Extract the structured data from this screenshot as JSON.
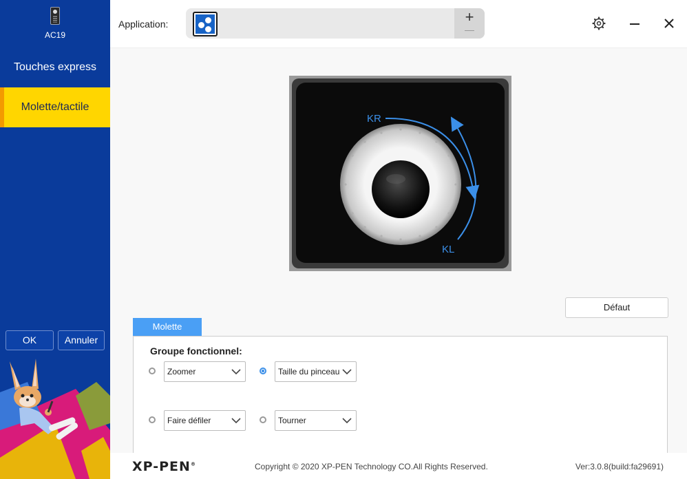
{
  "device": {
    "name": "AC19",
    "icon": "device-icon"
  },
  "sidebar": {
    "items": [
      {
        "label": "Touches express",
        "active": false
      },
      {
        "label": "Molette/tactile",
        "active": true
      }
    ],
    "ok_label": "OK",
    "cancel_label": "Annuler"
  },
  "topbar": {
    "application_label": "Application:",
    "app_icon": "generic-app-icon",
    "add_label": "+"
  },
  "wheel_image": {
    "kr_label": "KR",
    "kl_label": "KL"
  },
  "main": {
    "default_label": "Défaut",
    "tab_label": "Molette",
    "group_title": "Groupe fonctionnel:",
    "options": [
      {
        "value": "Zoomer",
        "selected": false
      },
      {
        "value": "Taille du pinceau",
        "selected": true
      },
      {
        "value": "Faire défiler",
        "selected": false
      },
      {
        "value": "Tourner",
        "selected": false
      }
    ]
  },
  "footer": {
    "logo": "XP-PEN",
    "copyright": "Copyright © 2020 XP-PEN Technology CO.All Rights Reserved.",
    "version": "Ver:3.0.8(build:fa29691)"
  },
  "colors": {
    "sidebar": "#0a3b9b",
    "active_item": "#ffd600",
    "accent": "#f39a00",
    "tab": "#4a9ff5",
    "arrow": "#3b8fe8"
  }
}
